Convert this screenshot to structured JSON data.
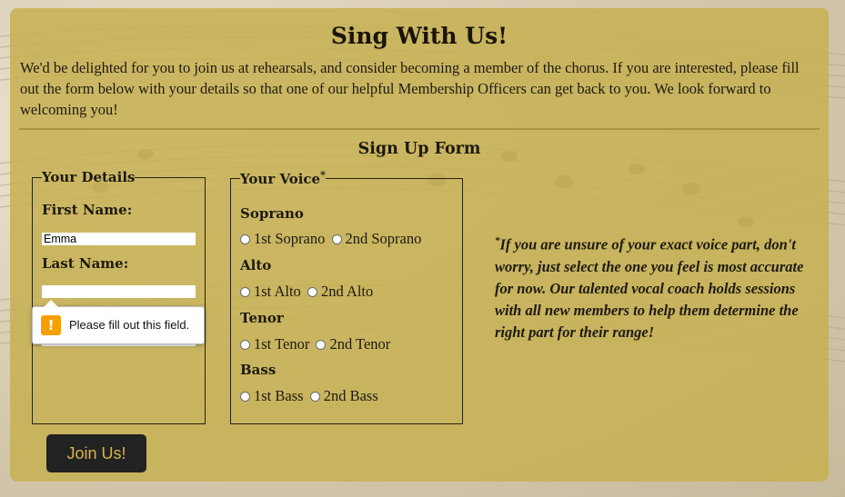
{
  "page": {
    "title": "Sing With Us!",
    "intro": "We'd be delighted for you to join us at rehearsals, and consider becoming a member of the chorus. If you are interested, please fill out the form below with your details so that one of our helpful Membership Officers can get back to you. We look forward to welcoming you!",
    "form_title": "Sign Up Form"
  },
  "details": {
    "legend": "Your Details",
    "first_name_label": "First Name:",
    "first_name_value": "Emma",
    "last_name_label": "Last Name:",
    "last_name_value": ""
  },
  "tooltip": {
    "icon": "warning-icon",
    "message": "Please fill out this field."
  },
  "voice": {
    "legend": "Your Voice",
    "legend_mark": "*",
    "groups": [
      {
        "label": "Soprano",
        "options": [
          "1st Soprano",
          "2nd Soprano"
        ]
      },
      {
        "label": "Alto",
        "options": [
          "1st Alto",
          "2nd Alto"
        ]
      },
      {
        "label": "Tenor",
        "options": [
          "1st Tenor",
          "2nd Tenor"
        ]
      },
      {
        "label": "Bass",
        "options": [
          "1st Bass",
          "2nd Bass"
        ]
      }
    ]
  },
  "note": {
    "mark": "*",
    "text": "If you are unsure of your exact voice part, don't worry, just select the one you feel is most accurate for now. Our talented vocal coach holds sessions with all new members to help them determine the right part for their range!"
  },
  "submit_label": "Join Us!",
  "colors": {
    "card": "#c6b052",
    "button_bg": "#232222",
    "button_text": "#d9b44a",
    "warning": "#f5a000"
  }
}
